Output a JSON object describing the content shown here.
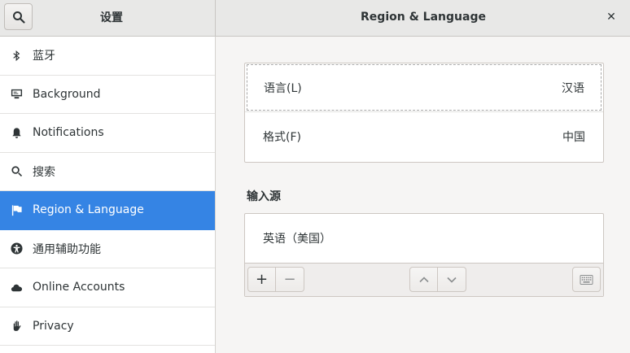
{
  "header": {
    "left_title": "设置",
    "main_title": "Region & Language",
    "close_glyph": "✕"
  },
  "sidebar": {
    "items": [
      {
        "label": "蓝牙",
        "icon": "bluetooth-icon",
        "active": false
      },
      {
        "label": "Background",
        "icon": "background-icon",
        "active": false
      },
      {
        "label": "Notifications",
        "icon": "bell-icon",
        "active": false
      },
      {
        "label": "搜索",
        "icon": "search-icon",
        "active": false
      },
      {
        "label": "Region & Language",
        "icon": "flag-icon",
        "active": true
      },
      {
        "label": "通用辅助功能",
        "icon": "accessibility-icon",
        "active": false
      },
      {
        "label": "Online Accounts",
        "icon": "cloud-icon",
        "active": false
      },
      {
        "label": "Privacy",
        "icon": "hand-icon",
        "active": false
      }
    ]
  },
  "main": {
    "language": {
      "label": "语言(L)",
      "value": "汉语"
    },
    "formats": {
      "label": "格式(F)",
      "value": "中国"
    },
    "input_sources_title": "输入源",
    "input_sources": [
      {
        "label": "英语（美国）"
      }
    ],
    "toolbar": {
      "add": "+",
      "remove": "−"
    }
  },
  "colors": {
    "accent": "#3584e4",
    "header_bg": "#e8e8e7",
    "window_bg": "#f6f5f4"
  }
}
